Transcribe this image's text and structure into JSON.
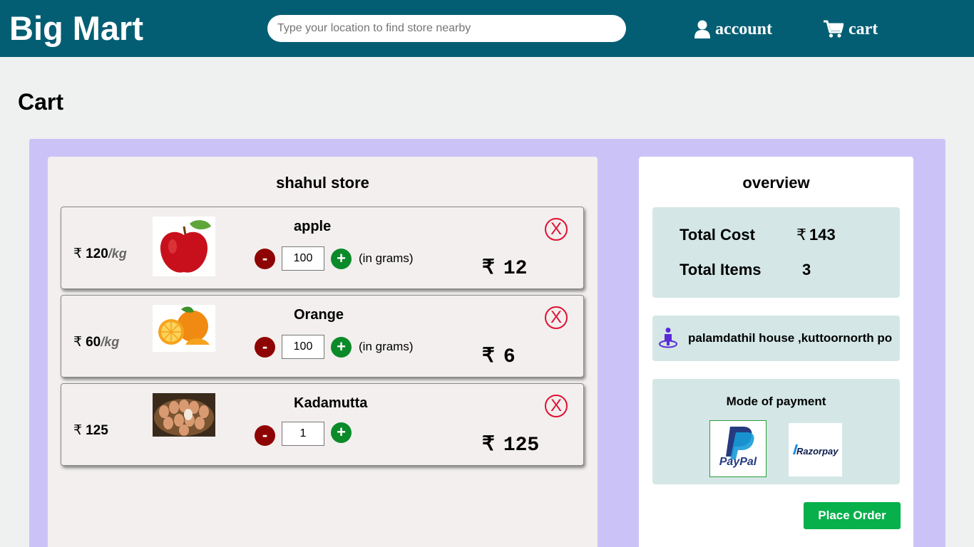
{
  "header": {
    "brand": "Big Mart",
    "search_placeholder": "Type your location to find store nearby",
    "account_label": "account",
    "cart_label": "cart"
  },
  "page_title": "Cart",
  "store": {
    "name": "shahul store",
    "currency": "₹",
    "items": [
      {
        "name": "apple",
        "rate": "120",
        "rate_unit": "/kg",
        "quantity": "100",
        "unit_note": "(in grams)",
        "price": "12",
        "image": "apple-image",
        "remove_label": "X"
      },
      {
        "name": "Orange",
        "rate": "60",
        "rate_unit": "/kg",
        "quantity": "100",
        "unit_note": "(in grams)",
        "price": "6",
        "image": "orange-image",
        "remove_label": "X"
      },
      {
        "name": "Kadamutta",
        "rate": "125",
        "rate_unit": "",
        "quantity": "1",
        "unit_note": "",
        "price": "125",
        "image": "eggs-image",
        "remove_label": "X"
      }
    ],
    "minus_label": "-",
    "plus_label": "+"
  },
  "overview": {
    "title": "overview",
    "total_cost_label": "Total Cost",
    "total_cost_value": "143",
    "total_items_label": "Total Items",
    "total_items_value": "3",
    "address": "palamdathil house ,kuttoornorth po",
    "payment_title": "Mode of payment",
    "payment_options": [
      "PayPal",
      "Razorpay"
    ],
    "selected_payment": "PayPal",
    "place_order_label": "Place Order"
  },
  "colors": {
    "header_bg": "#035e74",
    "panel_bg": "#cbc3f8",
    "minus_button": "#8e0303",
    "plus_button": "#0b8a2a",
    "remove_icon": "#e01030",
    "place_order": "#07b04b",
    "overview_box": "#d4e6e6"
  }
}
